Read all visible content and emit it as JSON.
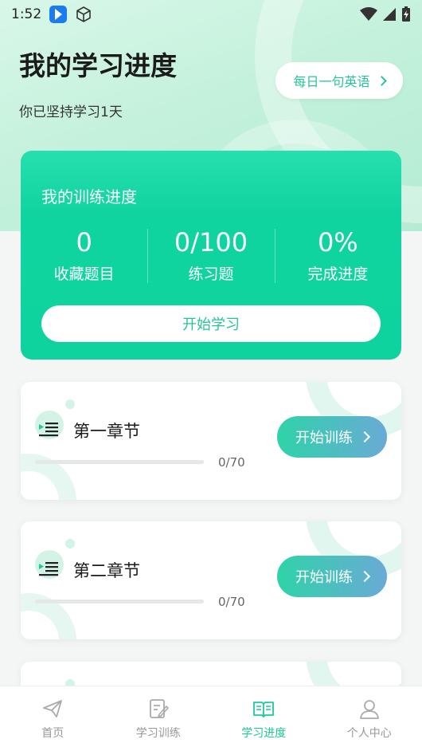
{
  "status_bar": {
    "time": "1:52"
  },
  "header": {
    "title": "我的学习进度",
    "subtitle": "你已坚持学习1天",
    "daily_english_label": "每日一句英语"
  },
  "progress_card": {
    "title": "我的训练进度",
    "stats": [
      {
        "value": "0",
        "label": "收藏题目"
      },
      {
        "value": "0/100",
        "label": "练习题"
      },
      {
        "value": "0%",
        "label": "完成进度"
      }
    ],
    "start_label": "开始学习"
  },
  "chapters": [
    {
      "title": "第一章节",
      "count": "0/70",
      "progress": 0,
      "button_label": "开始训练"
    },
    {
      "title": "第二章节",
      "count": "0/70",
      "progress": 0,
      "button_label": "开始训练"
    }
  ],
  "tabs": [
    {
      "label": "首页",
      "icon": "paper-plane-icon"
    },
    {
      "label": "学习训练",
      "icon": "edit-note-icon"
    },
    {
      "label": "学习进度",
      "icon": "open-book-icon",
      "active": true
    },
    {
      "label": "个人中心",
      "icon": "person-icon"
    }
  ],
  "colors": {
    "accent": "#1dc999",
    "card": "#0fd39e"
  }
}
